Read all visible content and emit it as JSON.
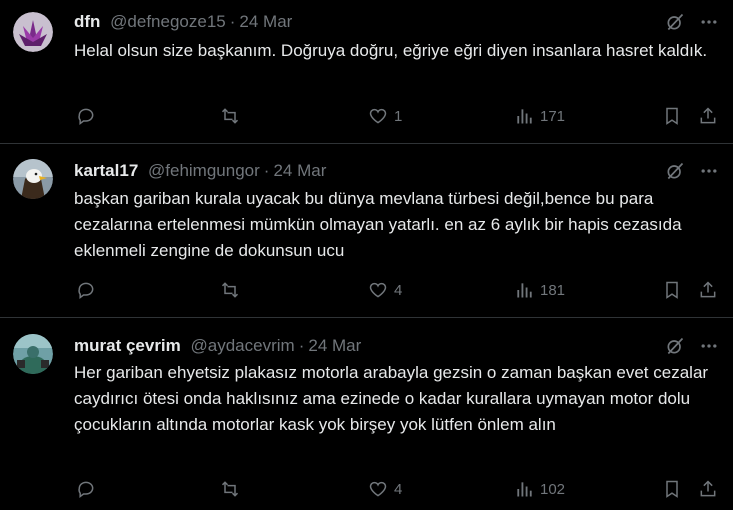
{
  "tweets": [
    {
      "name": "dfn",
      "handle": "@defnegoze15",
      "date": "24 Mar",
      "text": "Helal olsun size başkanım. Doğruya doğru, eğriye eğri diyen insanlara hasret kaldık.",
      "replies": "",
      "retweets": "",
      "likes": "1",
      "views": "171"
    },
    {
      "name": "kartal17",
      "handle": "@fehimgungor",
      "date": "24 Mar",
      "text": "başkan gariban kurala uyacak bu dünya mevlana türbesi değil,bence bu para cezalarına ertelenmesi mümkün olmayan yatarlı. en az 6 aylık bir hapis cezasıda eklenmeli zengine de dokunsun ucu",
      "replies": "",
      "retweets": "",
      "likes": "4",
      "views": "181"
    },
    {
      "name": "murat çevrim",
      "handle": "@aydacevrim",
      "date": "24 Mar",
      "text": "Her gariban ehyetsiz plakasız motorla arabayla gezsin o zaman başkan  evet cezalar caydırıcı ötesi onda haklısınız ama ezinede o kadar kurallara uymayan motor dolu çocukların altında motorlar kask yok birşey yok lütfen önlem alın",
      "replies": "",
      "retweets": "",
      "likes": "4",
      "views": "102"
    }
  ],
  "icons": {
    "grok": "grok-icon",
    "more": "more-icon",
    "reply": "reply-icon",
    "retweet": "retweet-icon",
    "like": "like-icon",
    "views": "views-icon",
    "bookmark": "bookmark-icon",
    "share": "share-icon"
  },
  "colors": {
    "background": "#000000",
    "text": "#e7e9ea",
    "muted": "#71767b",
    "divider": "#2f3336"
  }
}
